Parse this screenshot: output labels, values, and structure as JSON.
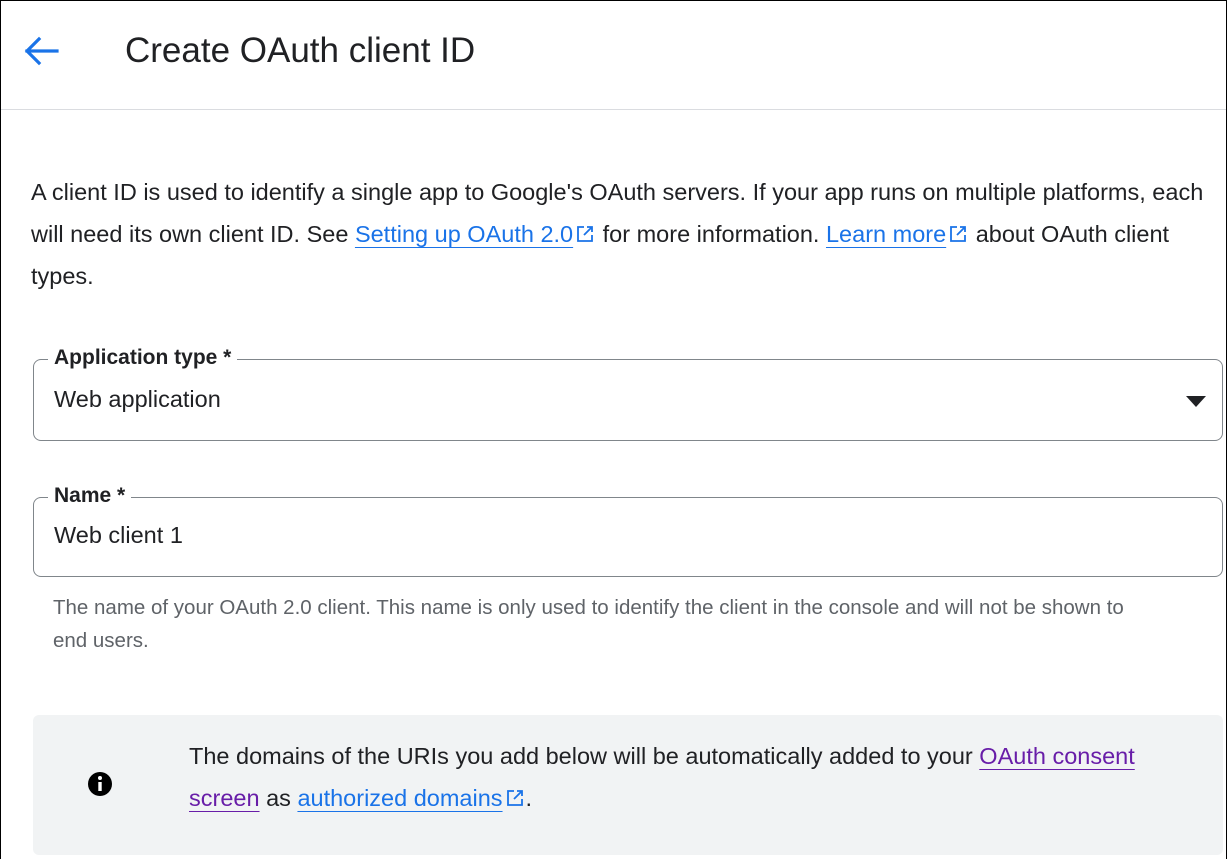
{
  "header": {
    "title": "Create OAuth client ID"
  },
  "intro": {
    "text1": "A client ID is used to identify a single app to Google's OAuth servers. If your app runs on multiple platforms, each will need its own client ID. See ",
    "link1": "Setting up OAuth 2.0",
    "text2": " for more information. ",
    "link2": "Learn more",
    "text3": " about OAuth client types."
  },
  "app_type": {
    "label": "Application type *",
    "value": "Web application"
  },
  "name": {
    "label": "Name *",
    "value": "Web client 1",
    "hint": "The name of your OAuth 2.0 client. This name is only used to identify the client in the console and will not be shown to end users."
  },
  "callout": {
    "text1": "The domains of the URIs you add below will be automatically added to your ",
    "link1": "OAuth consent screen",
    "text2": " as ",
    "link2": "authorized domains",
    "text3": "."
  },
  "colors": {
    "link": "#1a73e8",
    "visited_link": "#681da8",
    "text": "#202124",
    "hint": "#5f6368",
    "callout_bg": "#f1f3f4"
  },
  "icons": [
    "arrow-back-icon",
    "open-in-new-icon",
    "arrow-drop-down-icon",
    "info-icon"
  ]
}
